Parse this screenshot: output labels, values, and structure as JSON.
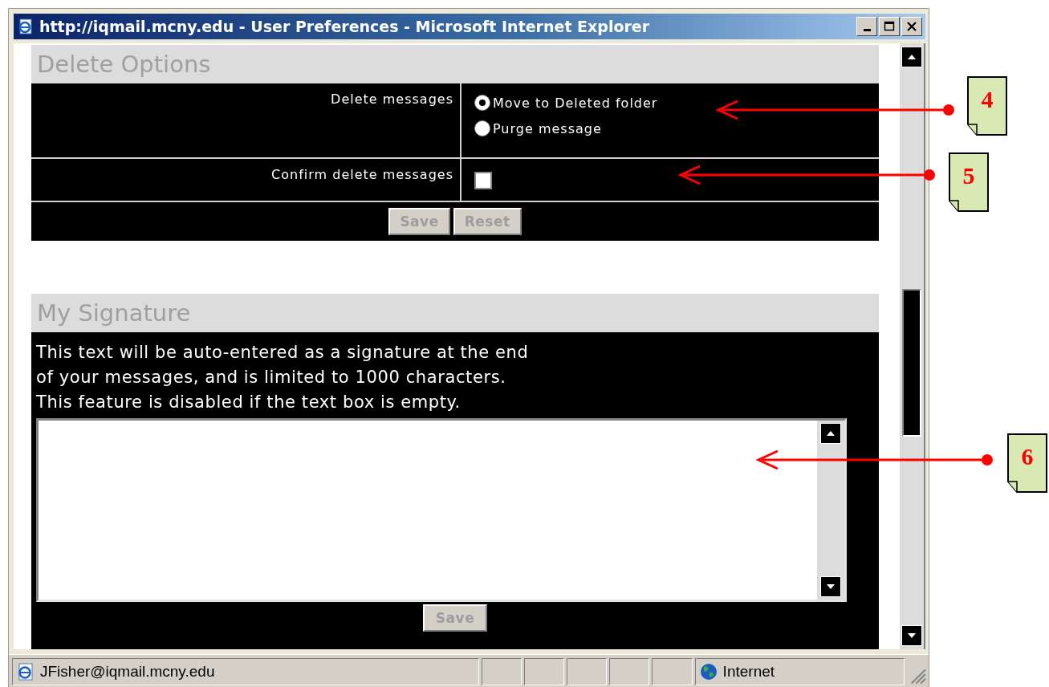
{
  "window": {
    "title": "http://iqmail.mcny.edu - User Preferences - Microsoft Internet Explorer"
  },
  "delete_options": {
    "heading": "Delete Options",
    "rows": [
      {
        "label": "Delete messages",
        "kind": "radio",
        "options": [
          {
            "label": "Move to Deleted folder",
            "selected": true
          },
          {
            "label": "Purge message",
            "selected": false
          }
        ]
      },
      {
        "label": "Confirm delete messages",
        "kind": "checkbox",
        "checked": false
      }
    ],
    "buttons": [
      {
        "label": "Save",
        "disabled": true
      },
      {
        "label": "Reset",
        "disabled": true
      }
    ]
  },
  "signature": {
    "heading": "My Signature",
    "description": [
      "This text will be auto-entered as a signature at the end",
      "of your messages, and is limited to 1000 characters.",
      "This feature is disabled if the text box is empty."
    ],
    "button": {
      "label": "Save",
      "disabled": true
    }
  },
  "status_bar": {
    "text": "JFisher@iqmail.mcny.edu",
    "zone": "Internet"
  },
  "callouts": [
    {
      "label": "4"
    },
    {
      "label": "5"
    },
    {
      "label": "6"
    }
  ]
}
